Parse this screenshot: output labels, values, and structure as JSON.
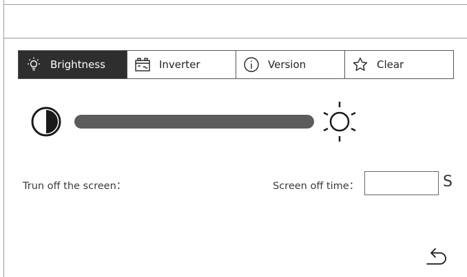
{
  "tabs": [
    {
      "label": "Brightness",
      "icon": "light-bulb-icon",
      "active": true
    },
    {
      "label": "Inverter",
      "icon": "battery-inverter-icon",
      "active": false
    },
    {
      "label": "Version",
      "icon": "info-icon",
      "active": false
    },
    {
      "label": "Clear",
      "icon": "star-icon",
      "active": false
    }
  ],
  "brightness": {
    "level": 1.0,
    "min_icon": "contrast-icon",
    "max_icon": "sun-icon"
  },
  "screen_off": {
    "turn_off_label": "Trun off the screen：",
    "time_label": "Screen off time：",
    "time_value": "",
    "unit": "S"
  },
  "footer": {
    "back_icon": "back-arrow-icon"
  },
  "colors": {
    "active_tab_bg": "#2e2e2e",
    "slider": "#5c5c5c",
    "rule": "#9a9a9a"
  }
}
